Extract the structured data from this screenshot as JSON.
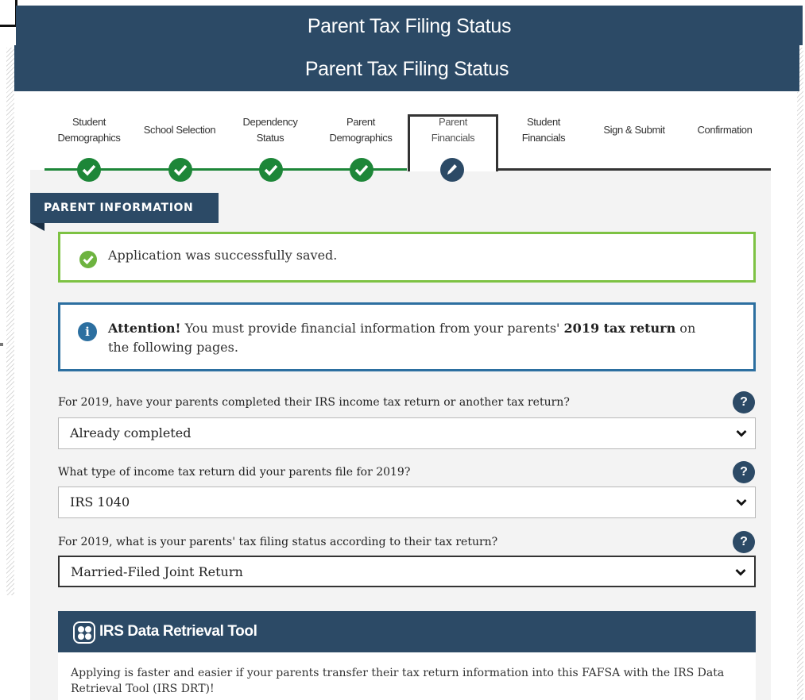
{
  "window": {
    "title": "Parent Tax Filing Status"
  },
  "page": {
    "title": "Parent Tax Filing Status"
  },
  "steps": [
    {
      "label": "Student Demographics",
      "state": "complete"
    },
    {
      "label": "School Selection",
      "state": "complete"
    },
    {
      "label": "Dependency Status",
      "state": "complete"
    },
    {
      "label": "Parent Demographics",
      "state": "complete"
    },
    {
      "label": "Parent Financials",
      "state": "current"
    },
    {
      "label": "Student Financials",
      "state": "upcoming"
    },
    {
      "label": "Sign & Submit",
      "state": "upcoming"
    },
    {
      "label": "Confirmation",
      "state": "upcoming"
    }
  ],
  "section": {
    "title": "PARENT INFORMATION"
  },
  "alerts": {
    "success": {
      "text": "Application was successfully saved.",
      "icon": "check-circle-icon"
    },
    "attention": {
      "lead": "Attention!",
      "text_before": " You must provide financial information from your parents' ",
      "emphasis": "2019 tax return",
      "text_after": " on the following pages.",
      "icon": "info-icon"
    }
  },
  "questions": [
    {
      "label": "For 2019, have your parents completed their IRS income tax return or another tax return?",
      "value": "Already completed",
      "help": "?"
    },
    {
      "label": "What type of income tax return did your parents file for 2019?",
      "value": "IRS 1040",
      "help": "?"
    },
    {
      "label": "For 2019, what is your parents' tax filing status according to their tax return?",
      "value": "Married-Filed Joint Return",
      "help": "?"
    }
  ],
  "drt": {
    "title": "IRS Data Retrieval Tool",
    "text": "Applying is faster and easier if your parents transfer their tax return information into this FAFSA with the IRS Data Retrieval Tool (IRS DRT)!"
  },
  "colors": {
    "header": "#2c4a66",
    "success": "#7dc243",
    "complete": "#1d8638",
    "info": "#2c6fa0"
  }
}
